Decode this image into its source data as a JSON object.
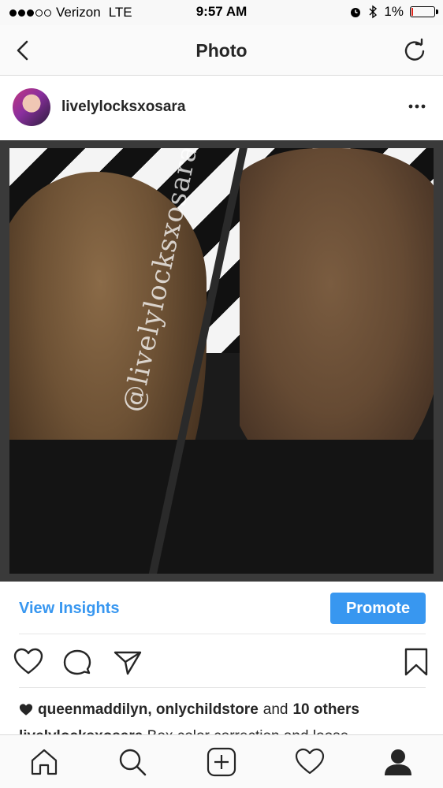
{
  "status_bar": {
    "carrier": "Verizon",
    "network": "LTE",
    "time": "9:57 AM",
    "battery": "1%",
    "battery_level": 0.01,
    "signal_bars_filled": 3,
    "signal_bars_total": 5
  },
  "nav": {
    "title": "Photo",
    "back_icon": "chevron-left-icon",
    "refresh_icon": "refresh-icon"
  },
  "post": {
    "username": "livelylocksxosara",
    "more_icon": "more-dots-icon",
    "watermark": "@livelylocksxosara"
  },
  "actions": {
    "view_insights": "View Insights",
    "promote": "Promote",
    "accent_color": "#3897f0"
  },
  "likes": {
    "users": "queenmaddilyn, onlychildstore",
    "and": "and",
    "others": "10 others"
  },
  "caption": {
    "username": "livelylocksxosara",
    "text": "Box color correction and loose"
  },
  "tabs": [
    "home-icon",
    "search-icon",
    "add-icon",
    "heart-icon",
    "profile-icon"
  ]
}
